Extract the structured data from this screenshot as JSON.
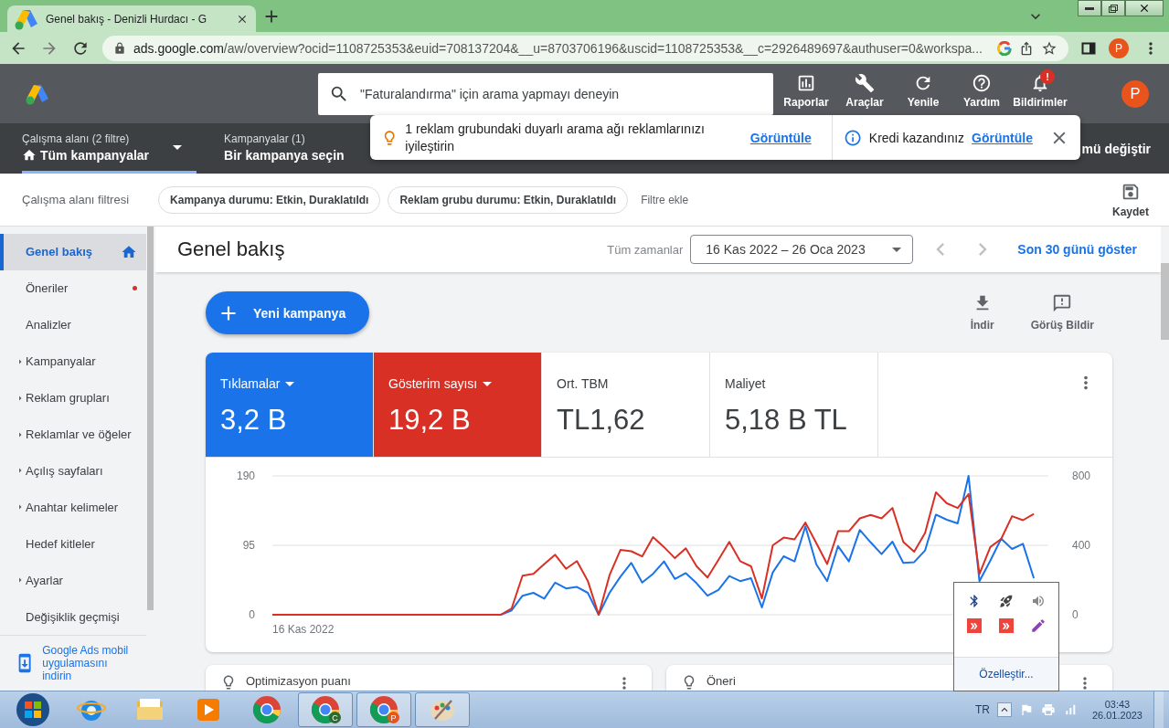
{
  "browser": {
    "tab_title": "Genel bakış - Denizli Hurdacı - G",
    "url_host": "ads.google.com",
    "url_path": "/aw/overview?ocid=1108725353&euid=708137204&__u=8703706196&uscid=1108725353&__c=2926489697&authuser=0&workspa...",
    "avatar": "P"
  },
  "header": {
    "search": {
      "placeholder": "\"Faturalandırma\" için arama yapmayı deneyin"
    },
    "actions": [
      {
        "kind": "reports",
        "label": "Raporlar"
      },
      {
        "kind": "tools",
        "label": "Araçlar"
      },
      {
        "kind": "refresh",
        "label": "Yenile"
      },
      {
        "kind": "help",
        "label": "Yardım"
      },
      {
        "kind": "notifications",
        "label": "Bildirimler",
        "badge": "!"
      }
    ],
    "avatar": "P"
  },
  "scope_bar": {
    "workspace": {
      "label": "Çalışma alanı (2 filtre)",
      "value": "Tüm kampanyalar"
    },
    "campaign": {
      "label": "Kampanyalar (1)",
      "value": "Bir kampanya seçin"
    },
    "view_switch": "mü değiştir"
  },
  "toast": {
    "message": "1 reklam grubundaki duyarlı arama ağı reklamlarınızı iyileştirin",
    "link": "Görüntüle",
    "credit": "Kredi kazandınız",
    "credit_link": "Görüntüle"
  },
  "filter_bar": {
    "title": "Çalışma alanı filtresi",
    "chips": [
      "Kampanya durumu: Etkin, Duraklatıldı",
      "Reklam grubu durumu: Etkin, Duraklatıldı"
    ],
    "add": "Filtre ekle",
    "save": "Kaydet"
  },
  "sidebar": {
    "items": [
      {
        "label": "Genel bakış",
        "kind": "home",
        "selected": true,
        "expandable": false,
        "alert": false
      },
      {
        "label": "Öneriler",
        "kind": "link",
        "selected": false,
        "expandable": false,
        "alert": true
      },
      {
        "label": "Analizler",
        "kind": "link",
        "selected": false,
        "expandable": false,
        "alert": false
      },
      {
        "label": "Kampanyalar",
        "kind": "link",
        "selected": false,
        "expandable": true,
        "alert": false
      },
      {
        "label": "Reklam grupları",
        "kind": "link",
        "selected": false,
        "expandable": true,
        "alert": false
      },
      {
        "label": "Reklamlar ve öğeler",
        "kind": "link",
        "selected": false,
        "expandable": true,
        "alert": false
      },
      {
        "label": "Açılış sayfaları",
        "kind": "link",
        "selected": false,
        "expandable": true,
        "alert": false
      },
      {
        "label": "Anahtar kelimeler",
        "kind": "link",
        "selected": false,
        "expandable": true,
        "alert": false
      },
      {
        "label": "Hedef kitleler",
        "kind": "link",
        "selected": false,
        "expandable": false,
        "alert": false
      },
      {
        "label": "Ayarlar",
        "kind": "link",
        "selected": false,
        "expandable": true,
        "alert": false
      },
      {
        "label": "Değişiklik geçmişi",
        "kind": "link",
        "selected": false,
        "expandable": false,
        "alert": false
      }
    ],
    "promo": "Google Ads mobil uygulamasını indirin"
  },
  "page": {
    "title": "Genel bakış",
    "range_label": "Tüm zamanlar",
    "range": "16 Kas 2022 – 26 Oca 2023",
    "last30": "Son 30 günü göster",
    "new_campaign": "Yeni kampanya",
    "download": "İndir",
    "feedback": "Görüş Bildir"
  },
  "metrics": [
    {
      "label": "Tıklamalar",
      "value": "3,2 B",
      "selected": true,
      "color": "#1a73e8"
    },
    {
      "label": "Gösterim sayısı",
      "value": "19,2 B",
      "selected": true,
      "color": "#d93025"
    },
    {
      "label": "Ort. TBM",
      "value": "TL1,62",
      "selected": false
    },
    {
      "label": "Maliyet",
      "value": "5,18 B TL",
      "selected": false
    }
  ],
  "chart_start": "16 Kas 2022",
  "chart_data": {
    "type": "line",
    "ylim": [
      0,
      190
    ],
    "yticks": [
      0,
      95,
      190
    ],
    "y2lim": [
      0,
      800
    ],
    "y2ticks": [
      0,
      400,
      800
    ],
    "series": [
      {
        "color": "#1a73e8",
        "values": [
          null,
          null,
          null,
          null,
          null,
          null,
          null,
          null,
          null,
          null,
          null,
          null,
          null,
          null,
          null,
          null,
          null,
          null,
          null,
          null,
          null,
          0,
          6,
          26,
          30,
          22,
          44,
          36,
          38,
          30,
          0,
          30,
          52,
          71,
          44,
          56,
          73,
          49,
          57,
          43,
          26,
          34,
          53,
          46,
          50,
          10,
          58,
          80,
          73,
          121,
          69,
          46,
          94,
          73,
          116,
          99,
          83,
          100,
          71,
          72,
          88,
          137,
          130,
          125,
          190,
          46,
          74,
          104,
          90,
          97,
          50,
          null
        ]
      },
      {
        "color": "#d93025",
        "axis": "y2",
        "values": [
          0,
          0,
          0,
          0,
          0,
          0,
          0,
          0,
          0,
          0,
          0,
          0,
          0,
          0,
          0,
          0,
          0,
          0,
          0,
          0,
          0,
          0,
          37,
          225,
          235,
          292,
          346,
          265,
          309,
          195,
          0,
          228,
          373,
          366,
          336,
          447,
          390,
          326,
          383,
          279,
          215,
          316,
          420,
          309,
          279,
          94,
          400,
          444,
          434,
          531,
          413,
          292,
          481,
          481,
          555,
          575,
          555,
          615,
          420,
          363,
          471,
          706,
          642,
          615,
          696,
          235,
          390,
          437,
          568,
          545,
          581,
          null
        ]
      }
    ]
  },
  "cards": [
    "Optimizasyon puanı",
    "Öneri"
  ],
  "tray_popup": {
    "icons": [
      {
        "kind": "bluetooth"
      },
      {
        "kind": "rocket"
      },
      {
        "kind": "volume"
      },
      {
        "kind": "remote"
      },
      {
        "kind": "remote"
      },
      {
        "kind": "pen"
      }
    ],
    "customize": "Özelleştir..."
  },
  "taskbar": {
    "apps": [
      {
        "kind": "start"
      },
      {
        "kind": "ie"
      },
      {
        "kind": "folder"
      },
      {
        "kind": "media"
      },
      {
        "kind": "chrome"
      },
      {
        "kind": "chrome",
        "badge": "C",
        "color": "#2e6b2e"
      },
      {
        "kind": "chrome",
        "badge": "P",
        "color": "#e8541c"
      },
      {
        "kind": "paint"
      }
    ],
    "language": "TR",
    "time": "03:43",
    "date": "26.01.2023"
  }
}
